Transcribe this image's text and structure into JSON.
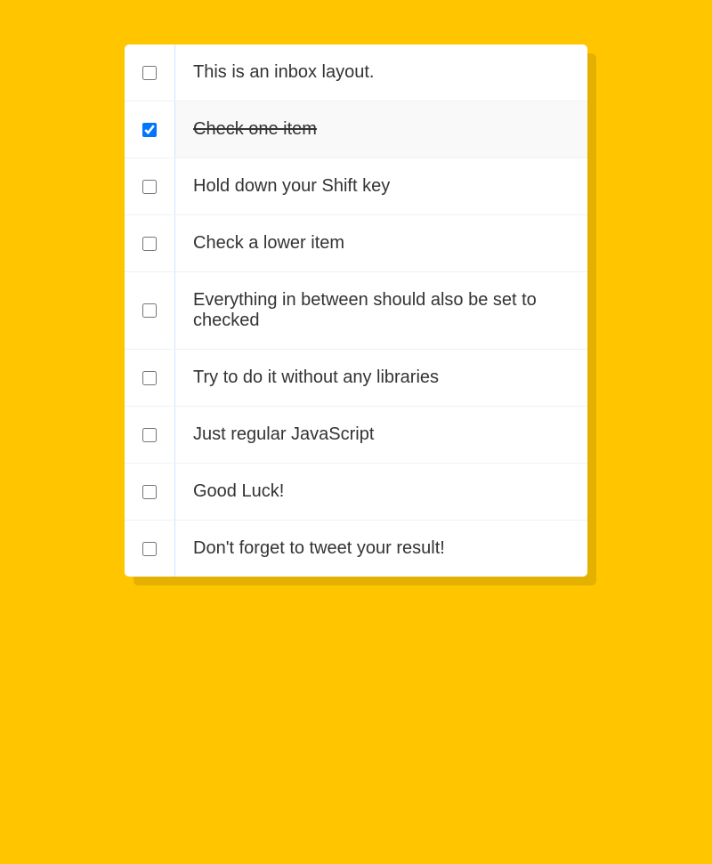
{
  "inbox": {
    "items": [
      {
        "label": "This is an inbox layout.",
        "checked": false
      },
      {
        "label": "Check one item",
        "checked": true
      },
      {
        "label": "Hold down your Shift key",
        "checked": false
      },
      {
        "label": "Check a lower item",
        "checked": false
      },
      {
        "label": "Everything in between should also be set to checked",
        "checked": false
      },
      {
        "label": "Try to do it without any libraries",
        "checked": false
      },
      {
        "label": "Just regular JavaScript",
        "checked": false
      },
      {
        "label": "Good Luck!",
        "checked": false
      },
      {
        "label": "Don't forget to tweet your result!",
        "checked": false
      }
    ]
  }
}
